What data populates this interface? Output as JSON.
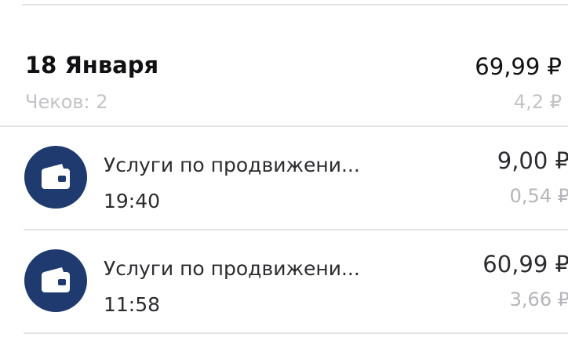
{
  "day": {
    "title": "18 Января",
    "receipts_count": "Чеков: 2",
    "total": "69,99 ₽",
    "cashback": "4,2 ₽"
  },
  "transactions": [
    {
      "icon": "wallet-icon",
      "title": "Услуги по продвижени...",
      "time": "19:40",
      "amount": "9,00 ₽",
      "cashback": "0,54 ₽"
    },
    {
      "icon": "wallet-icon",
      "title": "Услуги по продвижени...",
      "time": "11:58",
      "amount": "60,99 ₽",
      "cashback": "3,66 ₽"
    }
  ],
  "colors": {
    "icon_background": "#1e3a6e",
    "muted_text": "#c3c3c7",
    "divider": "#e4e4e6"
  }
}
